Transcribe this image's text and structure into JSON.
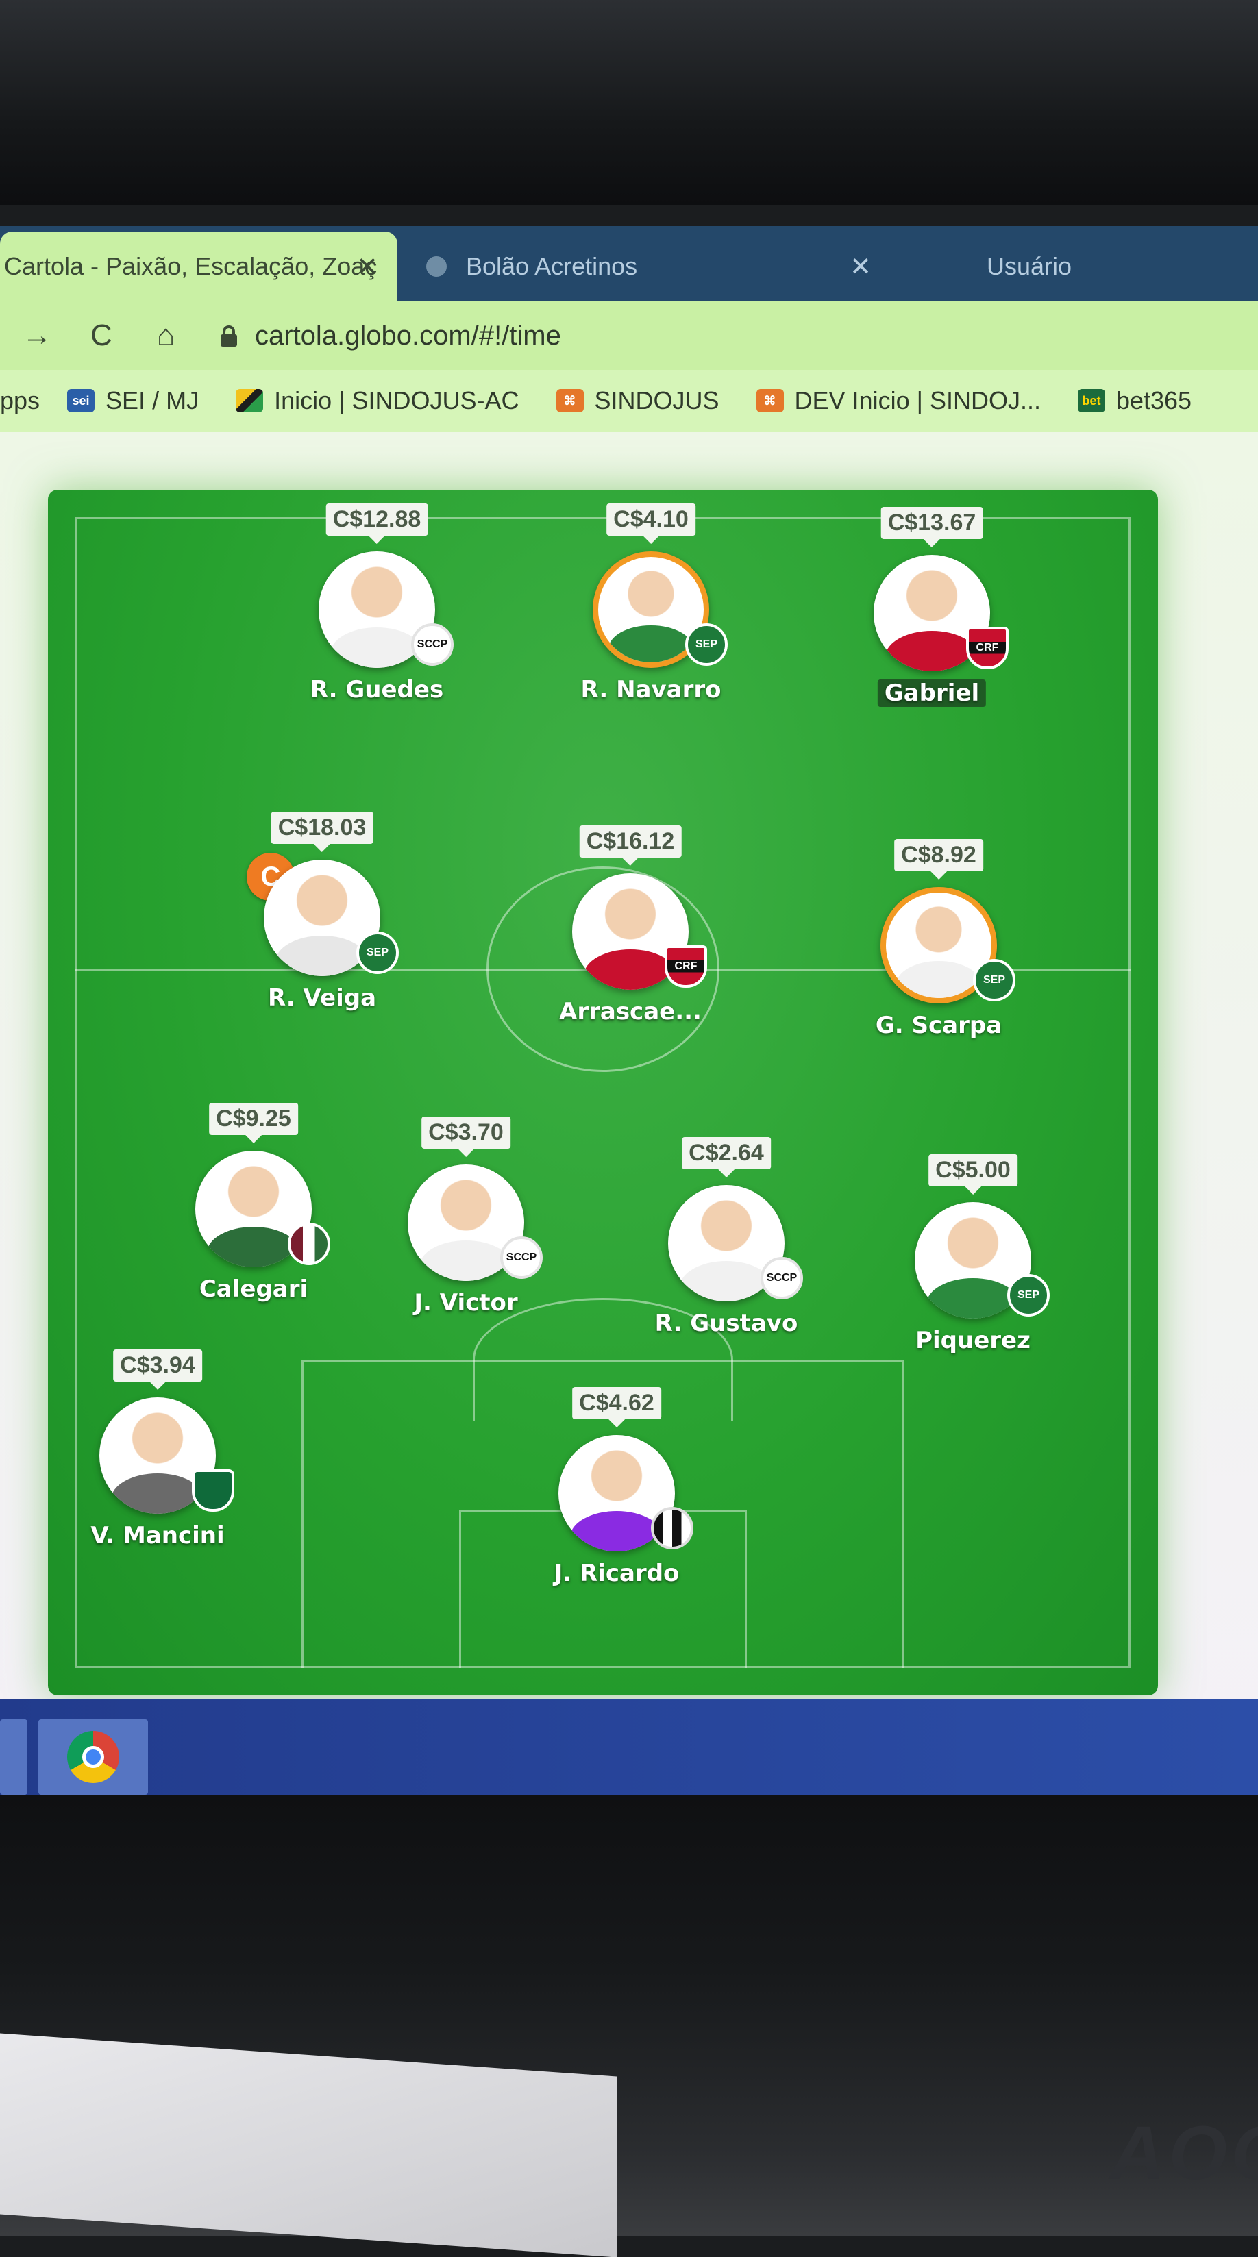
{
  "browser": {
    "tabs": [
      {
        "label": "Cartola - Paixão, Escalação, Zoaç",
        "active": true
      },
      {
        "label": "Bolão Acretinos",
        "active": false
      },
      {
        "label": "Usuário",
        "active": false
      }
    ],
    "close_symbol": "✕",
    "url": "cartola.globo.com/#!/time",
    "nav": {
      "back": "→",
      "reload": "C",
      "home": "⌂"
    },
    "bookmarks": [
      {
        "label": "pps",
        "icon": ""
      },
      {
        "label": "SEI / MJ",
        "icon": "sei"
      },
      {
        "label": "Inicio | SINDOJUS-AC",
        "icon": "flag"
      },
      {
        "label": "SINDOJUS",
        "icon": "sindojus"
      },
      {
        "label": "DEV Inicio | SINDOJ...",
        "icon": "sindojus"
      },
      {
        "label": "bet365",
        "icon": "bet365"
      }
    ]
  },
  "lineup": {
    "captain_badge": "C",
    "players": [
      {
        "name": "R. Guedes",
        "price": "C$12.88",
        "club": "corinthians"
      },
      {
        "name": "R. Navarro",
        "price": "C$4.10",
        "club": "palmeiras"
      },
      {
        "name": "Gabriel",
        "price": "C$13.67",
        "club": "flamengo"
      },
      {
        "name": "R. Veiga",
        "price": "C$18.03",
        "club": "palmeiras",
        "captain": true
      },
      {
        "name": "Arrascae...",
        "price": "C$16.12",
        "club": "flamengo"
      },
      {
        "name": "G. Scarpa",
        "price": "C$8.92",
        "club": "palmeiras"
      },
      {
        "name": "Calegari",
        "price": "C$9.25",
        "club": "fluminense"
      },
      {
        "name": "J. Victor",
        "price": "C$3.70",
        "club": "corinthians"
      },
      {
        "name": "R. Gustavo",
        "price": "C$2.64",
        "club": "corinthians"
      },
      {
        "name": "Piquerez",
        "price": "C$5.00",
        "club": "palmeiras"
      },
      {
        "name": "V. Mancini",
        "price": "C$3.94",
        "club": "america-mg"
      },
      {
        "name": "J. Ricardo",
        "price": "C$4.62",
        "club": "ceara"
      }
    ]
  },
  "colors": {
    "pitch": "#27a12f",
    "captain": "#ef7b22",
    "highlight_ring": "#f29a22"
  },
  "monitor": {
    "brand": "AOC"
  }
}
